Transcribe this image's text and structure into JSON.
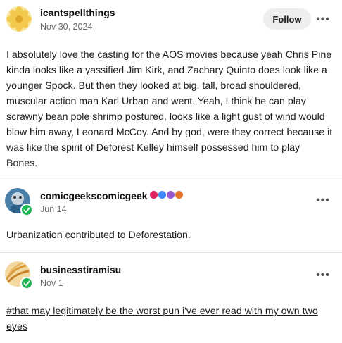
{
  "posts": [
    {
      "username": "icantspellthings",
      "date": "Nov 30, 2024",
      "follow_label": "Follow",
      "more_label": "•••",
      "body": "I absolutely love the casting for the AOS movies because yeah Chris Pine kinda looks like a yassified Jim Kirk, and Zachary Quinto does look like a younger Spock. But then they looked at big, tall, broad shouldered, muscular action man Karl Urban and went. Yeah, I think he can play scrawny bean pole shrimp postured, looks like a light gust of wind would blow him away, Leonard McCoy. And by god, were they correct because it was like the spirit of Deforest Kelley himself possessed him to play Bones."
    },
    {
      "username": "comicgeekscomicgeek",
      "date": "Jun 14",
      "more_label": "•••",
      "body": "Urbanization contributed to Deforestation."
    },
    {
      "username": "businesstiramisu",
      "date": "Nov 1",
      "more_label": "•••",
      "body": "#that may legitimately be the worst pun i've ever read with my own two eyes"
    }
  ],
  "colors": {
    "accent_green": "#1db954",
    "divider": "#e5e5e5",
    "badge_red": "#e0245e",
    "badge_blue": "#3d8bfd",
    "badge_purple": "#9b59d0",
    "badge_orange": "#e8742a"
  }
}
